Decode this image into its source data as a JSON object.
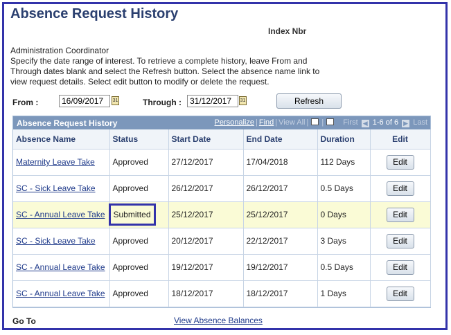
{
  "page": {
    "title": "Absence Request History",
    "index_label": "Index Nbr",
    "role": "Administration Coordinator",
    "instructions": "Specify the date range of interest. To retrieve a complete history, leave From and Through dates blank and select the Refresh button. Select the absence name link to view request details. Select edit button to modify or delete the request."
  },
  "filters": {
    "from_label": "From :",
    "from_value": "16/09/2017",
    "through_label": "Through :",
    "through_value": "31/12/2017",
    "refresh_label": "Refresh"
  },
  "grid": {
    "title": "Absence Request History",
    "personalize": "Personalize",
    "find": "Find",
    "view_all": "View All",
    "first": "First",
    "range": "1-6 of 6",
    "last": "Last",
    "columns": [
      "Absence Name",
      "Status",
      "Start Date",
      "End Date",
      "Duration",
      "Edit"
    ],
    "edit_label": "Edit",
    "rows": [
      {
        "name": "Maternity Leave Take",
        "status": "Approved",
        "start": "27/12/2017",
        "end": "17/04/2018",
        "duration": "112 Days"
      },
      {
        "name": "SC - Sick Leave Take",
        "status": "Approved",
        "start": "26/12/2017",
        "end": "26/12/2017",
        "duration": "0.5 Days"
      },
      {
        "name": "SC - Annual Leave Take",
        "status": "Submitted",
        "start": "25/12/2017",
        "end": "25/12/2017",
        "duration": "0 Days"
      },
      {
        "name": "SC - Sick Leave Take",
        "status": "Approved",
        "start": "20/12/2017",
        "end": "22/12/2017",
        "duration": "3 Days"
      },
      {
        "name": "SC - Annual Leave Take",
        "status": "Approved",
        "start": "19/12/2017",
        "end": "19/12/2017",
        "duration": "0.5 Days"
      },
      {
        "name": "SC - Annual Leave Take",
        "status": "Approved",
        "start": "18/12/2017",
        "end": "18/12/2017",
        "duration": "1 Days"
      }
    ]
  },
  "footer": {
    "goto_label": "Go To",
    "balances_link": "View Absence Balances"
  },
  "colors": {
    "frame": "#3333aa",
    "title": "#2a3f6f",
    "grid_header": "#7c97bb",
    "highlight_row": "#fafbd6",
    "link": "#1f3a8a"
  }
}
